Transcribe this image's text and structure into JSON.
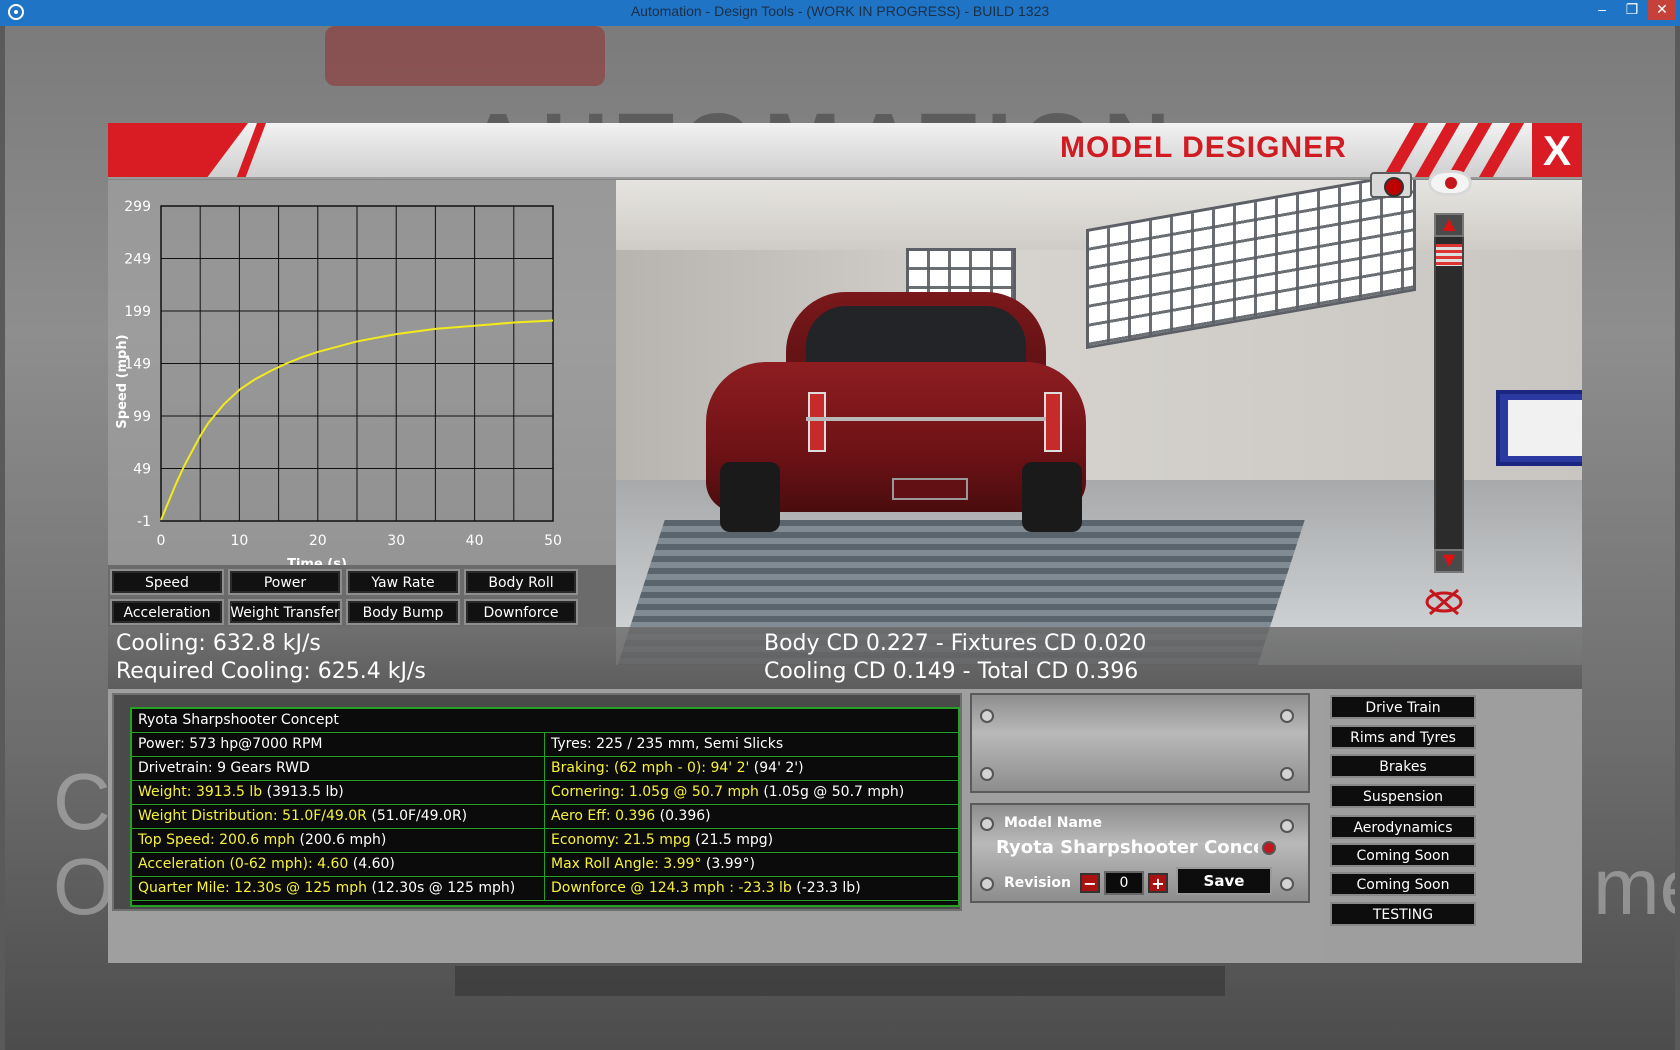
{
  "os": {
    "title": "Automation - Design Tools - (WORK IN PROGRESS) - BUILD 1323",
    "minimize": "–",
    "maximize": "❐",
    "close": "✕"
  },
  "background": {
    "logo": "AUTOMATION",
    "left_text_1": "C",
    "left_text_2": "O",
    "right_text": "me"
  },
  "header": {
    "title": "MODEL DESIGNER",
    "close_label": "X"
  },
  "chart_data": {
    "type": "line",
    "title": "",
    "xlabel": "Time (s)",
    "ylabel": "Speed (mph)",
    "xlim": [
      0,
      50
    ],
    "ylim": [
      -1,
      299
    ],
    "x_ticks": [
      "0",
      "10",
      "20",
      "30",
      "40",
      "50"
    ],
    "y_ticks": [
      "-1",
      "49",
      "99",
      "149",
      "199",
      "249",
      "299"
    ],
    "grid": true,
    "series": [
      {
        "color": "#f2ea1b",
        "x": [
          0,
          1,
          2,
          3,
          4,
          5,
          6,
          8,
          10,
          12,
          14,
          16,
          18,
          20,
          25,
          30,
          35,
          40,
          45,
          50
        ],
        "y": [
          0,
          18,
          36,
          52,
          66,
          80,
          92,
          110,
          124,
          134,
          142,
          149,
          155,
          160,
          170,
          177,
          182,
          185,
          188,
          190
        ]
      }
    ]
  },
  "graph_buttons": [
    "Speed",
    "Power",
    "Yaw Rate",
    "Body Roll",
    "Acceleration",
    "Weight Transfer",
    "Body Bump",
    "Downforce"
  ],
  "cooling": {
    "cooling": "Cooling: 632.8 kJ/s",
    "required": "Required Cooling: 625.4 kJ/s"
  },
  "aero": {
    "line1": "Body CD 0.227 - Fixtures CD 0.020",
    "line2": "Cooling CD 0.149 - Total CD 0.396"
  },
  "stats": {
    "car_name": "Ryota Sharpshooter Concept",
    "rows": [
      {
        "left": "Power: 573 hp@7000 RPM",
        "left_extra": "",
        "left_hl": false,
        "right": "Tyres: 225 / 235 mm, Semi Slicks",
        "right_extra": "",
        "right_hl": false
      },
      {
        "left": "Drivetrain: 9 Gears RWD",
        "left_extra": "",
        "left_hl": false,
        "right": "Braking: (62 mph - 0): 94' 2'",
        "right_extra": " (94' 2')",
        "right_hl": true
      },
      {
        "left": "Weight: 3913.5 lb",
        "left_extra": " (3913.5 lb)",
        "left_hl": true,
        "right": "Cornering: 1.05g @ 50.7 mph",
        "right_extra": " (1.05g @ 50.7 mph)",
        "right_hl": true
      },
      {
        "left": "Weight Distribution: 51.0F/49.0R",
        "left_extra": " (51.0F/49.0R)",
        "left_hl": true,
        "right": "Aero Eff: 0.396",
        "right_extra": " (0.396)",
        "right_hl": true
      },
      {
        "left": "Top Speed: 200.6 mph",
        "left_extra": " (200.6 mph)",
        "left_hl": true,
        "right": "Economy: 21.5 mpg",
        "right_extra": " (21.5 mpg)",
        "right_hl": true
      },
      {
        "left": "Acceleration (0-62 mph): 4.60",
        "left_extra": " (4.60)",
        "left_hl": true,
        "right": "Max Roll Angle: 3.99°",
        "right_extra": " (3.99°)",
        "right_hl": true
      },
      {
        "left": "Quarter Mile: 12.30s @ 125 mph",
        "left_extra": " (12.30s @ 125 mph)",
        "left_hl": true,
        "right": "Downforce @ 124.3 mph : -23.3 lb",
        "right_extra": " (-23.3 lb)",
        "right_hl": true
      }
    ]
  },
  "model": {
    "name_label": "Model Name",
    "name_value": "Ryota Sharpshooter Concept",
    "revision_label": "Revision",
    "revision_value": "0",
    "minus": "−",
    "plus": "+",
    "save_label": "Save"
  },
  "side_menu": [
    "Drive Train",
    "Rims and Tyres",
    "Brakes",
    "Suspension",
    "Aerodynamics",
    "Coming Soon",
    "Coming Soon",
    "TESTING"
  ],
  "scroll": {
    "up": "▲",
    "down": "▼"
  }
}
